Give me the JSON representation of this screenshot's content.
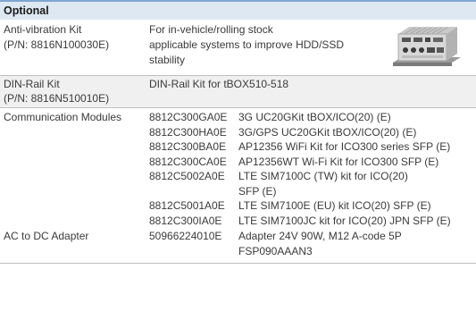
{
  "section": {
    "title": "Optional"
  },
  "rows": [
    {
      "label": [
        "Anti-vibration Kit",
        "(P/N: 8816N100030E)"
      ],
      "desc": [
        "For in-vehicle/rolling stock",
        "applicable systems to improve HDD/SSD",
        "stability"
      ]
    },
    {
      "label": [
        "DIN-Rail Kit",
        "(P/N: 8816N510010E)"
      ],
      "desc": [
        "DIN-Rail Kit for tBOX510-518"
      ]
    },
    {
      "label": [
        "Communication Modules"
      ],
      "modules": [
        {
          "code": "8812C300GA0E",
          "desc": [
            "3G UC20GKit tBOX/ICO(20) (E)"
          ]
        },
        {
          "code": "8812C300HA0E",
          "desc": [
            "3G/GPS UC20GKit tBOX/ICO(20) (E)"
          ]
        },
        {
          "code": "8812C300BA0E",
          "desc": [
            "AP12356 WiFi Kit for ICO300 series SFP (E)"
          ]
        },
        {
          "code": "8812C300CA0E",
          "desc": [
            "AP12356WT Wi-Fi Kit for ICO300 SFP (E)"
          ]
        },
        {
          "code": "8812C5002A0E",
          "desc": [
            "LTE SIM7100C (TW) kit for ICO(20)",
            "SFP (E)"
          ]
        },
        {
          "code": "8812C5001A0E",
          "desc": [
            "LTE SIM7100E (EU) kit ICO(20) SFP (E)"
          ]
        },
        {
          "code": "8812C300IA0E",
          "desc": [
            "LTE SIM7100JC kit for ICO(20) JPN SFP (E)"
          ]
        }
      ]
    },
    {
      "label": [
        "AC to DC Adapter"
      ],
      "modules": [
        {
          "code": "50966224010E",
          "desc": [
            "Adapter 24V 90W, M12 A-code 5P",
            "FSP090AAAN3"
          ]
        }
      ]
    }
  ],
  "image": {
    "icon": "embedded-computer-photo"
  }
}
